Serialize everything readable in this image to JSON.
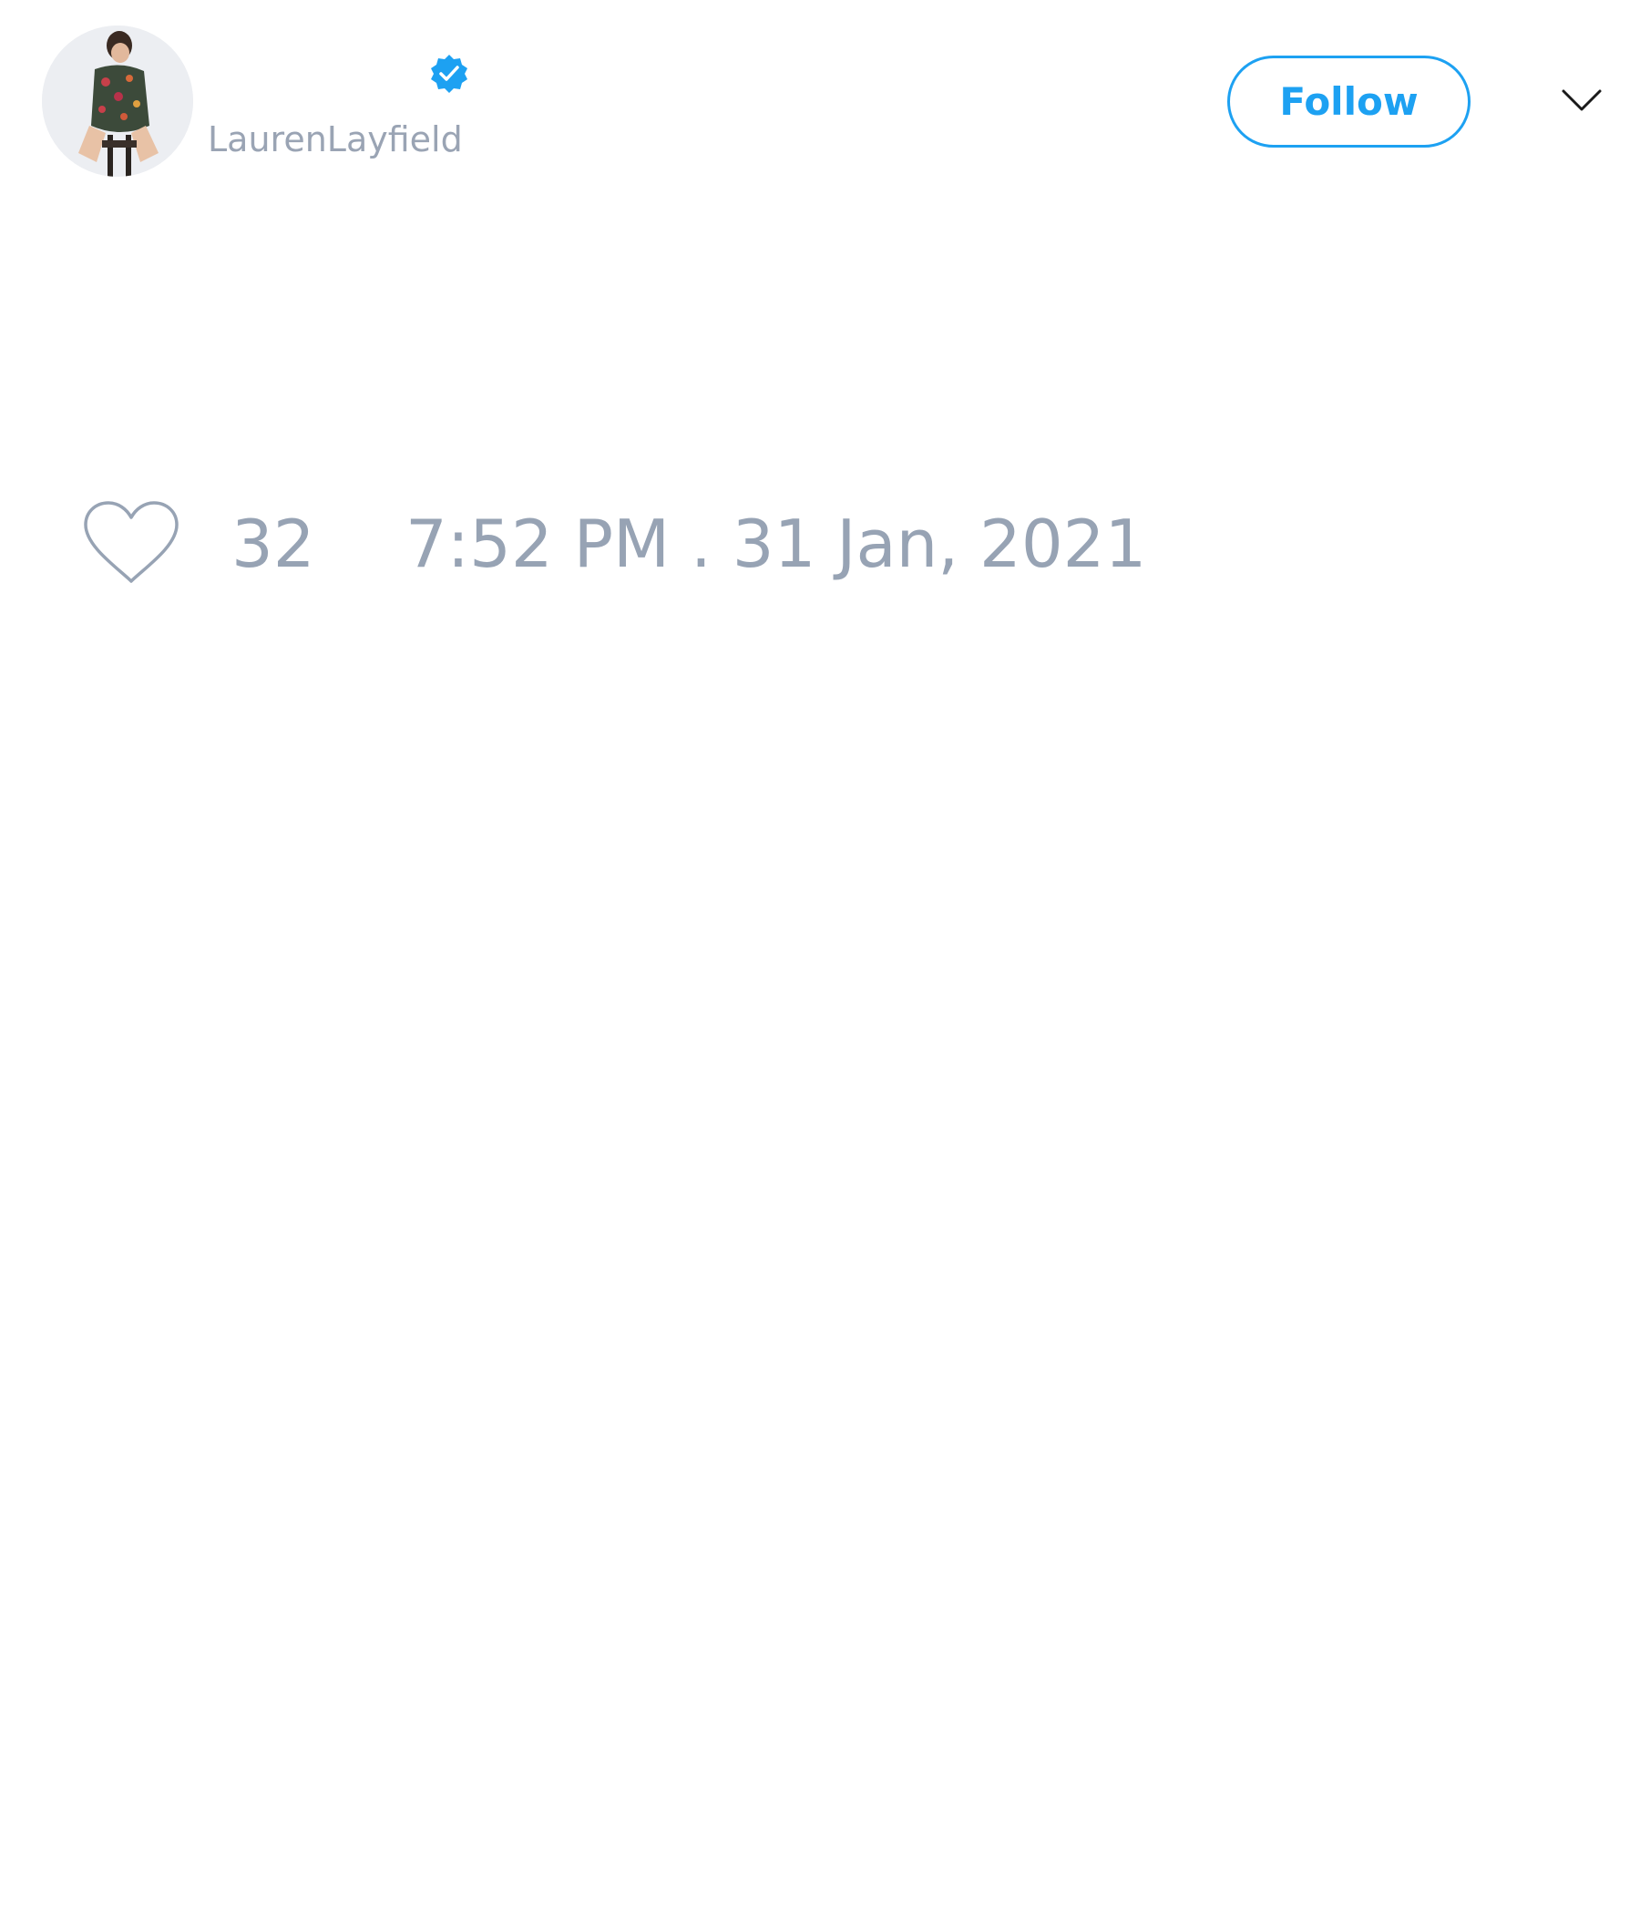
{
  "header": {
    "display_name": "",
    "handle": "LaurenLayfield",
    "verified": true,
    "follow_label": "Follow"
  },
  "icons": {
    "avatar": "avatar-photo",
    "verified": "verified-badge-icon",
    "menu": "chevron-down-icon",
    "like": "heart-icon"
  },
  "footer": {
    "like_count": "32",
    "timestamp": "7:52 PM . 31 Jan, 2021"
  },
  "colors": {
    "accent": "#1da1f2",
    "muted_text": "#97a3b4",
    "background": "#ffffff"
  }
}
